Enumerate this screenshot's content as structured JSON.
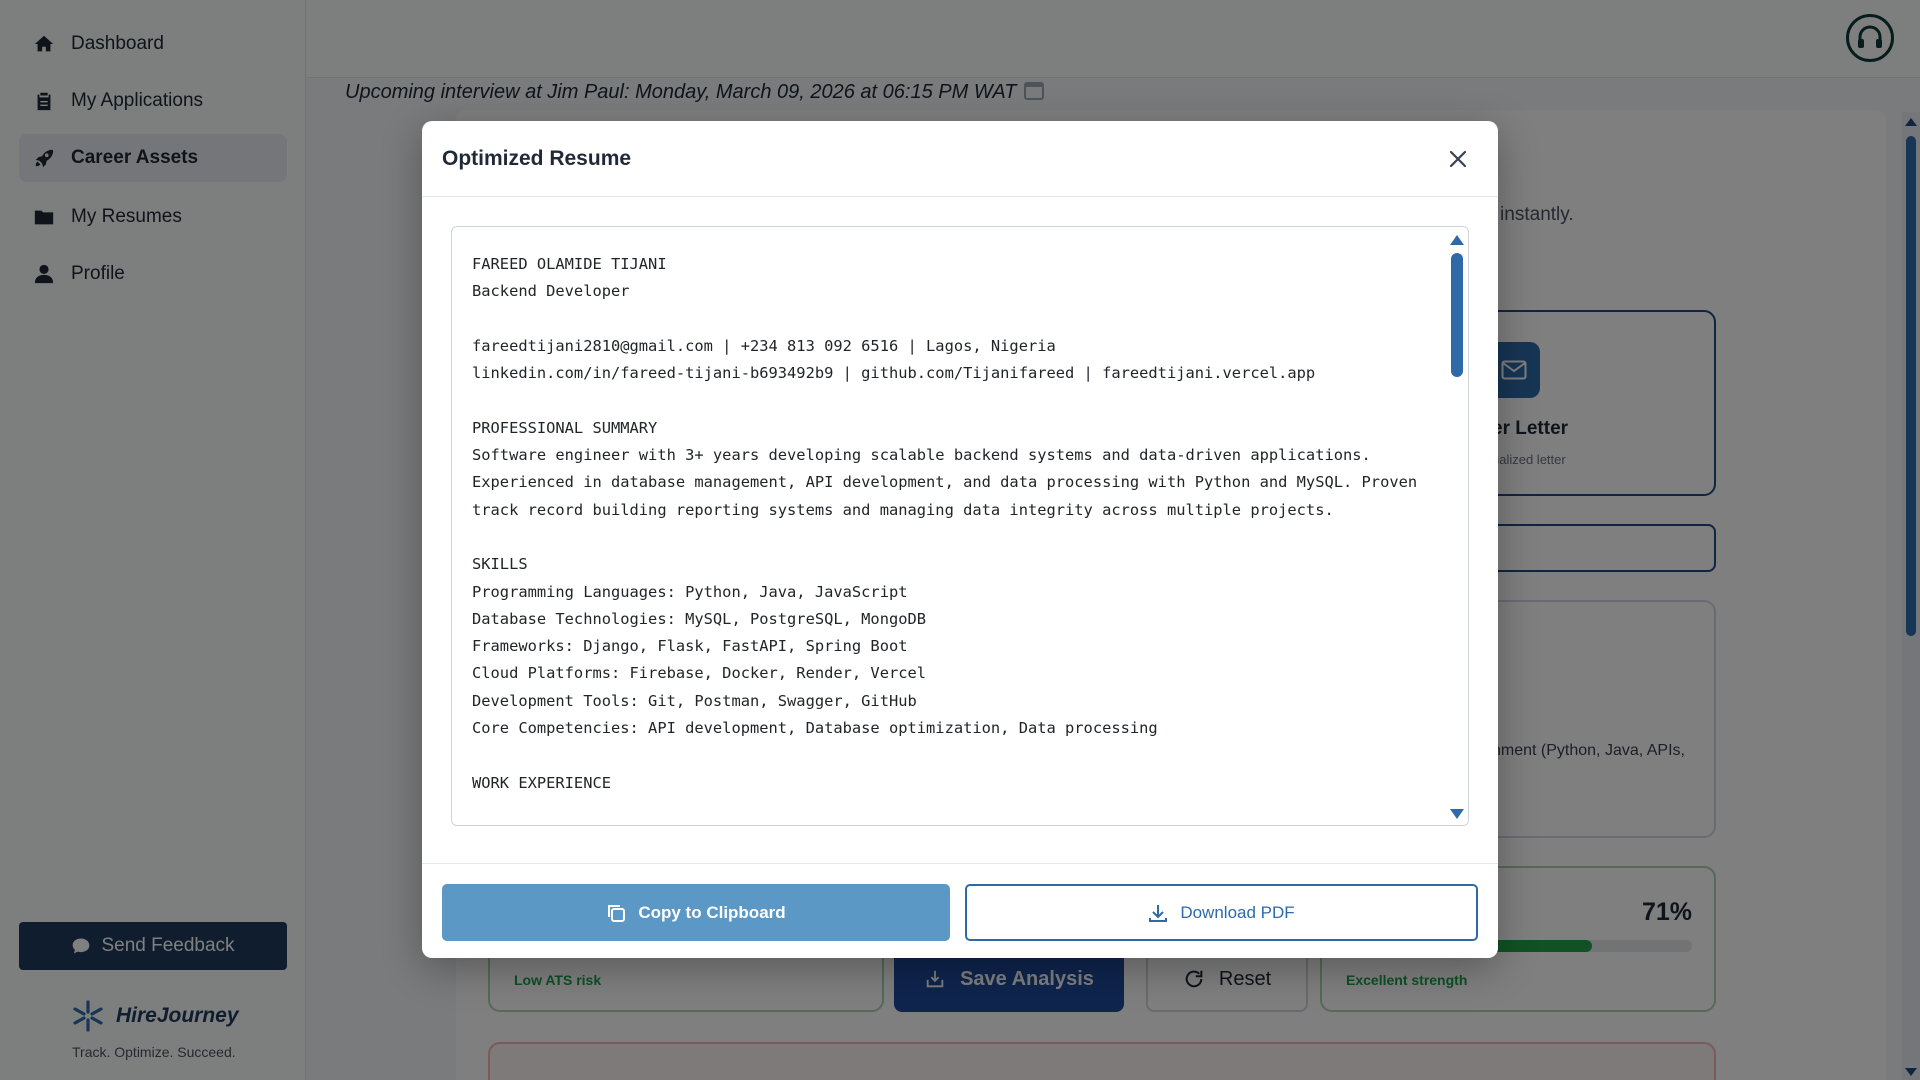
{
  "sidebar": {
    "items": [
      {
        "label": "Dashboard",
        "icon": "home-icon"
      },
      {
        "label": "My Applications",
        "icon": "clipboard-icon"
      },
      {
        "label": "Career Assets",
        "icon": "rocket-icon",
        "active": true
      },
      {
        "label": "My Resumes",
        "icon": "folder-icon"
      },
      {
        "label": "Profile",
        "icon": "user-icon"
      }
    ],
    "feedback_label": "Send Feedback",
    "brand_name": "HireJourney",
    "brand_tagline": "Track. Optimize. Succeed."
  },
  "header": {
    "interview_banner": "Upcoming interview at Jim Paul: Monday, March 09, 2026 at 06:15 PM WAT",
    "support_icon": "headset-icon"
  },
  "background": {
    "subtext_fragment": "ts instantly.",
    "cover_letter_title": "er Letter",
    "cover_letter_sub": "nalized letter",
    "skills_fragment": "nment (Python, Java, APIs,",
    "ats_status": "Low ATS risk",
    "strength_percent": "71%",
    "strength_value": 71,
    "strength_status": "Excellent strength",
    "save_label": "Save Analysis",
    "reset_label": "Reset"
  },
  "modal": {
    "title": "Optimized Resume",
    "close_icon": "close-icon",
    "resume_text": "FAREED OLAMIDE TIJANI\nBackend Developer\n\nfareedtijani2810@gmail.com | +234 813 092 6516 | Lagos, Nigeria\nlinkedin.com/in/fareed-tijani-b693492b9 | github.com/Tijanifareed | fareedtijani.vercel.app\n\nPROFESSIONAL SUMMARY\nSoftware engineer with 3+ years developing scalable backend systems and data-driven applications.\nExperienced in database management, API development, and data processing with Python and MySQL. Proven\ntrack record building reporting systems and managing data integrity across multiple projects.\n\nSKILLS\nProgramming Languages: Python, Java, JavaScript\nDatabase Technologies: MySQL, PostgreSQL, MongoDB\nFrameworks: Django, Flask, FastAPI, Spring Boot\nCloud Platforms: Firebase, Docker, Render, Vercel\nDevelopment Tools: Git, Postman, Swagger, GitHub\nCore Competencies: API development, Database optimization, Data processing\n\nWORK EXPERIENCE",
    "copy_label": "Copy to Clipboard",
    "download_label": "Download PDF"
  },
  "colors": {
    "primary_dark": "#1e3a5f",
    "primary": "#2f6aa8",
    "copy_button": "#5b98c6",
    "success": "#16a34a"
  }
}
